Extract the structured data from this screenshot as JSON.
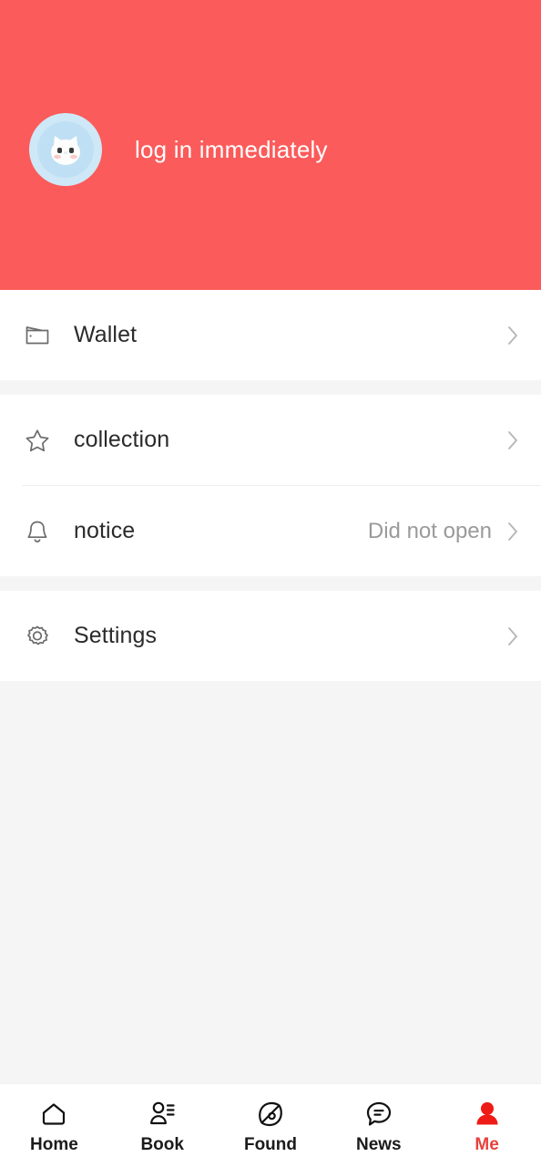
{
  "theme": {
    "header_red": "#FB5B5A",
    "active_red": "#E8413C",
    "page_bg": "#F5F5F5",
    "card_bg": "#FFFFFF",
    "label_color": "#2B2B2B",
    "value_color": "#9A9A9A"
  },
  "header": {
    "login_label": "log in immediately",
    "avatar_icon": "cat-avatar-icon"
  },
  "menu": {
    "groups": [
      {
        "rows": [
          {
            "icon": "wallet-icon",
            "label": "Wallet",
            "value": "",
            "chevron": "chevron-right-icon"
          }
        ]
      },
      {
        "rows": [
          {
            "icon": "star-icon",
            "label": "collection",
            "value": "",
            "chevron": "chevron-right-icon"
          },
          {
            "icon": "bell-icon",
            "label": "notice",
            "value": "Did not open",
            "chevron": "chevron-right-icon"
          }
        ]
      },
      {
        "rows": [
          {
            "icon": "gear-icon",
            "label": "Settings",
            "value": "",
            "chevron": "chevron-right-icon"
          }
        ]
      }
    ]
  },
  "tabbar": {
    "items": [
      {
        "label": "Home",
        "icon": "home-icon",
        "active": false
      },
      {
        "label": "Book",
        "icon": "contacts-icon",
        "active": false
      },
      {
        "label": "Found",
        "icon": "discover-icon",
        "active": false
      },
      {
        "label": "News",
        "icon": "chat-icon",
        "active": false
      },
      {
        "label": "Me",
        "icon": "person-icon",
        "active": true
      }
    ]
  }
}
